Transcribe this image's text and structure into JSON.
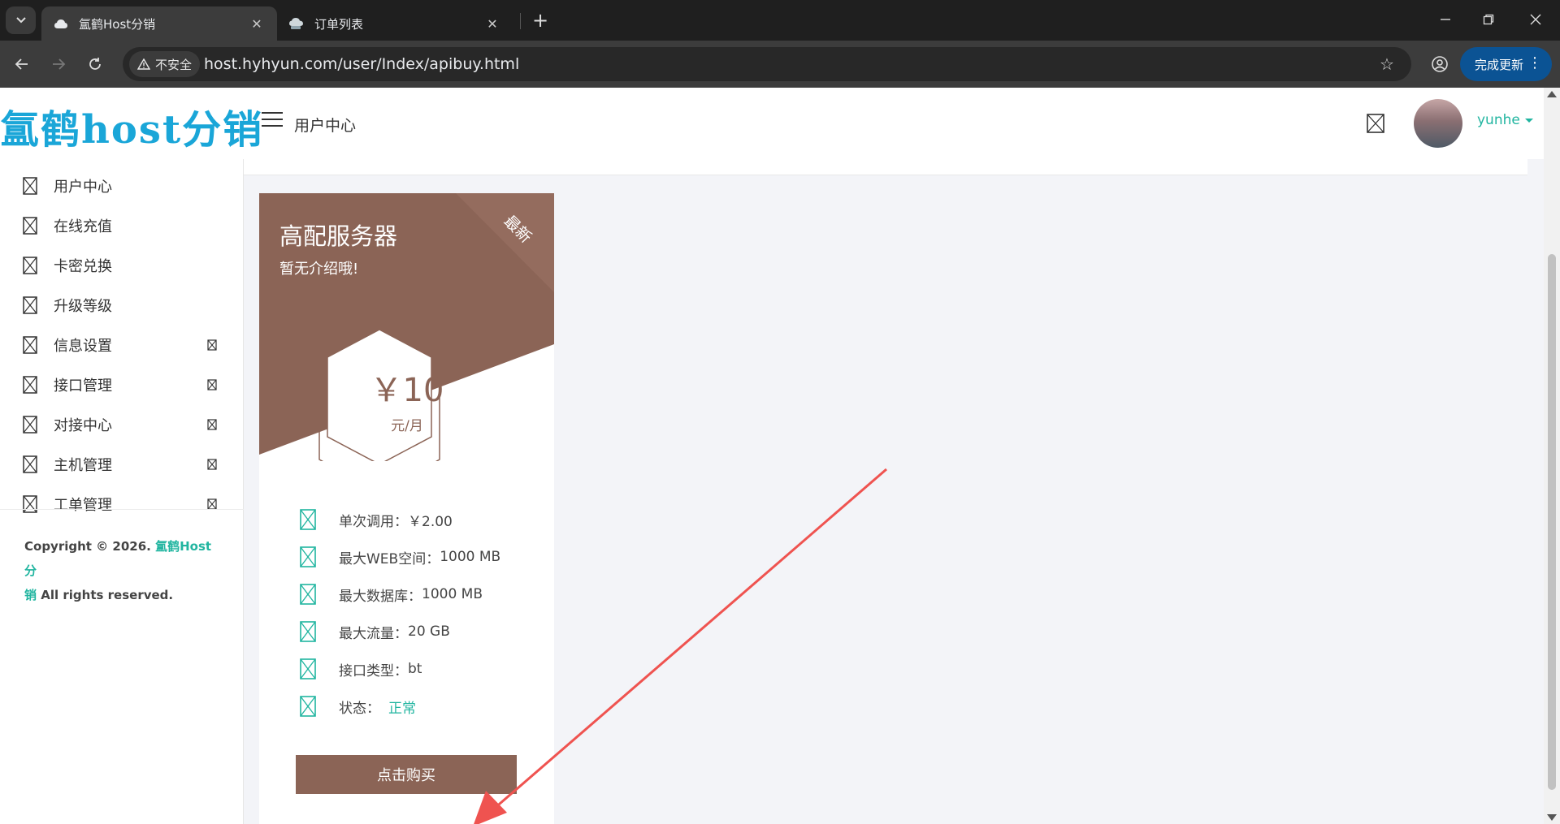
{
  "browser": {
    "tabs": [
      {
        "title": "氲鹤Host分销",
        "active": true,
        "icon": "cloud-icon"
      },
      {
        "title": "订单列表",
        "active": false,
        "icon": "cloud-server-icon"
      }
    ],
    "security_label": "不安全",
    "url": "host.hyhyun.com/user/Index/apibuy.html",
    "update_label": "完成更新"
  },
  "header": {
    "logo_text": "氲鹤host分销",
    "title": "用户中心",
    "username": "yunhe"
  },
  "sidebar": {
    "items": [
      {
        "label": "用户中心",
        "has_arrow": false
      },
      {
        "label": "在线充值",
        "has_arrow": false
      },
      {
        "label": "卡密兑换",
        "has_arrow": false
      },
      {
        "label": "升级等级",
        "has_arrow": false
      },
      {
        "label": "信息设置",
        "has_arrow": true
      },
      {
        "label": "接口管理",
        "has_arrow": true
      },
      {
        "label": "对接中心",
        "has_arrow": true
      },
      {
        "label": "主机管理",
        "has_arrow": true
      },
      {
        "label": "工单管理",
        "has_arrow": true
      }
    ],
    "copyright_prefix": "Copyright © 2026.",
    "copyright_brand_1": "氲鹤Host分",
    "copyright_brand_2": "销",
    "copyright_suffix": "All rights reserved."
  },
  "card": {
    "title": "高配服务器",
    "description": "暂无介绍哦!",
    "ribbon": "最新",
    "price": "￥10",
    "price_unit": "元/月",
    "features": [
      {
        "label": "单次调用：",
        "value": "￥2.00"
      },
      {
        "label": "最大WEB空间：",
        "value": "1000 MB"
      },
      {
        "label": "最大数据库：",
        "value": "1000 MB"
      },
      {
        "label": "最大流量：",
        "value": "20 GB"
      },
      {
        "label": "接口类型：",
        "value": "bt"
      },
      {
        "label": "状态：",
        "value": "正常"
      }
    ],
    "buy_label": "点击购买",
    "accent_color": "#8b6456"
  },
  "colors": {
    "brand": "#1aa6d8",
    "teal": "#21b5a0",
    "annotation_arrow": "#ef5350"
  }
}
